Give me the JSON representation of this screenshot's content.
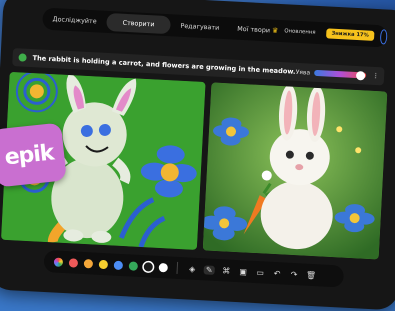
{
  "nav": {
    "items": [
      "Досліджуйте",
      "Створити",
      "Редагувати"
    ],
    "active_index": 1,
    "mine": "Мої твори",
    "update": "Оновлення",
    "badge": "Знижка 17%"
  },
  "prompt": {
    "text": "The rabbit is holding a carrot, and flowers are growing in the meadow.",
    "label": "Уява",
    "imagination_level": 0.9
  },
  "toolbar": {
    "colors": [
      "#ef5a5a",
      "#f4a73a",
      "#f6cf2f",
      "#4c8df5",
      "#35a85a",
      "#1a1a1a",
      "#ffffff"
    ],
    "selected_color_index": 5
  },
  "sticker": {
    "text": "epik"
  },
  "colors": {
    "canvas_left": "#3aa12f",
    "canvas_right": "#4f8a36",
    "accent": "#f6c21c"
  }
}
